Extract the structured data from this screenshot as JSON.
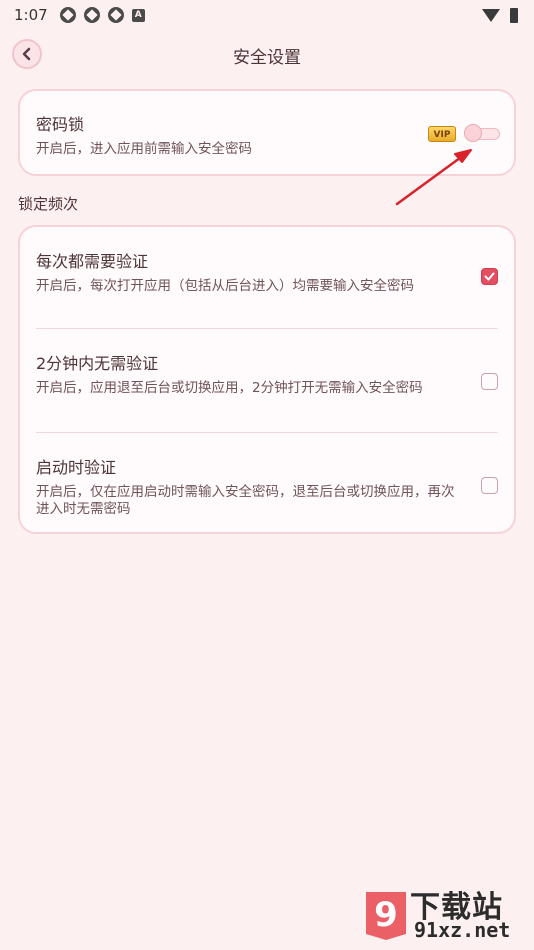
{
  "status_bar": {
    "time": "1:07",
    "notification_icons": [
      "notification-icon",
      "notification-icon",
      "notification-icon"
    ],
    "a_icon_label": "A"
  },
  "header": {
    "back_icon": "chevron-left-icon",
    "title": "安全设置"
  },
  "password_lock": {
    "title": "密码锁",
    "description": "开启后，进入应用前需输入安全密码",
    "vip_label": "VIP",
    "enabled": false
  },
  "lock_frequency": {
    "section_label": "锁定频次",
    "options": [
      {
        "title": "每次都需要验证",
        "description": "开启后，每次打开应用（包括从后台进入）均需要输入安全密码",
        "checked": true
      },
      {
        "title": "2分钟内无需验证",
        "description": "开启后，应用退至后台或切换应用，2分钟打开无需输入安全密码",
        "checked": false
      },
      {
        "title": "启动时验证",
        "description": "开启后，仅在应用启动时需输入安全密码，退至后台或切换应用，再次进入时无需密码",
        "checked": false
      }
    ]
  },
  "colors": {
    "accent": "#e34e62",
    "background": "#fdf0f1",
    "annotation_arrow": "#d9222b"
  },
  "watermark": {
    "name": "下载站",
    "url": "91xz.net",
    "logo_text": "9"
  }
}
